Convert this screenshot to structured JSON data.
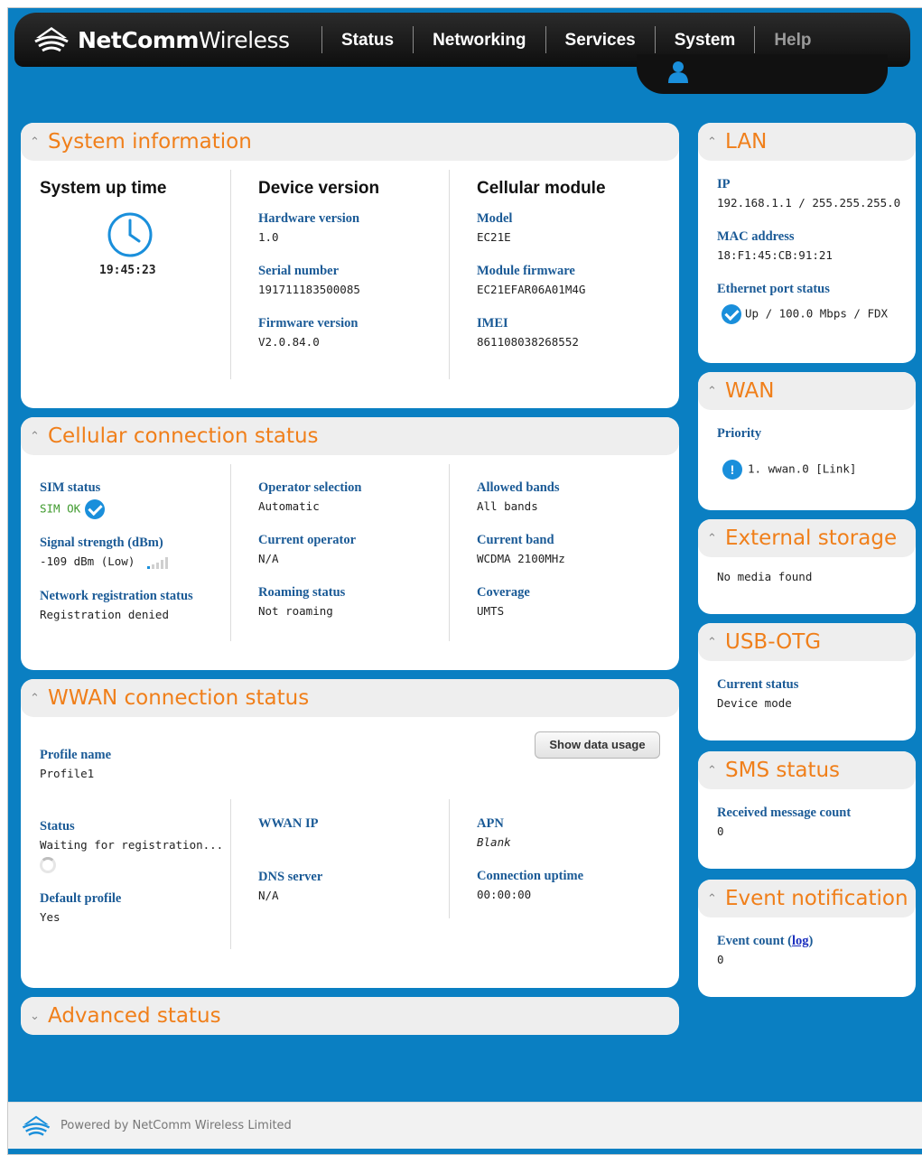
{
  "brand": {
    "bold": "NetComm",
    "light": "Wireless"
  },
  "nav": [
    "Status",
    "Networking",
    "Services",
    "System",
    "Help"
  ],
  "system_info": {
    "title": "System information",
    "uptime_title": "System up time",
    "uptime": "19:45:23",
    "device_title": "Device version",
    "hardware_label": "Hardware version",
    "hardware": "1.0",
    "serial_label": "Serial number",
    "serial": "191711183500085",
    "firmware_label": "Firmware version",
    "firmware": "V2.0.84.0",
    "cell_title": "Cellular module",
    "model_label": "Model",
    "model": "EC21E",
    "module_fw_label": "Module firmware",
    "module_fw": "EC21EFAR06A01M4G",
    "imei_label": "IMEI",
    "imei": "861108038268552"
  },
  "cellular": {
    "title": "Cellular connection status",
    "sim_label": "SIM status",
    "sim": "SIM OK",
    "signal_label": "Signal strength (dBm)",
    "signal": "-109 dBm (Low)",
    "netreg_label": "Network registration status",
    "netreg": "Registration denied",
    "opsel_label": "Operator selection",
    "opsel": "Automatic",
    "curop_label": "Current operator",
    "curop": "N/A",
    "roam_label": "Roaming status",
    "roam": "Not roaming",
    "bands_label": "Allowed bands",
    "bands": "All bands",
    "curband_label": "Current band",
    "curband": "WCDMA 2100MHz",
    "coverage_label": "Coverage",
    "coverage": "UMTS"
  },
  "wwan": {
    "title": "WWAN connection status",
    "show_usage": "Show data usage",
    "profile_label": "Profile name",
    "profile": "Profile1",
    "status_label": "Status",
    "status": "Waiting for registration...",
    "default_label": "Default profile",
    "default": "Yes",
    "ip_label": "WWAN IP",
    "dns_label": "DNS server",
    "dns": "N/A",
    "apn_label": "APN",
    "apn": "Blank",
    "uptime_label": "Connection uptime",
    "uptime": "00:00:00"
  },
  "advanced": {
    "title": "Advanced status"
  },
  "lan": {
    "title": "LAN",
    "ip_label": "IP",
    "ip": "192.168.1.1 / 255.255.255.0",
    "mac_label": "MAC address",
    "mac": "18:F1:45:CB:91:21",
    "eth_label": "Ethernet port status",
    "eth": "Up / 100.0 Mbps / FDX"
  },
  "wan": {
    "title": "WAN",
    "priority_label": "Priority",
    "priority": "1. wwan.0 [Link]"
  },
  "storage": {
    "title": "External storage",
    "value": "No media found"
  },
  "usbotg": {
    "title": "USB-OTG",
    "status_label": "Current status",
    "status": "Device mode"
  },
  "sms": {
    "title": "SMS status",
    "count_label": "Received message count",
    "count": "0"
  },
  "event": {
    "title": "Event notification",
    "count_label": "Event count (",
    "log": "log",
    "close": ")",
    "count": "0"
  },
  "footer": {
    "text": "Powered by NetComm Wireless Limited"
  }
}
